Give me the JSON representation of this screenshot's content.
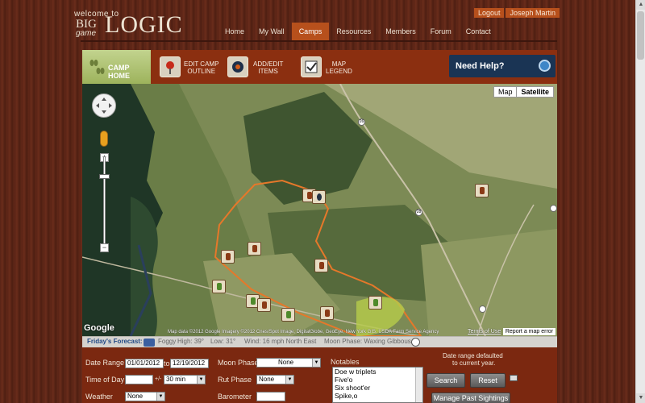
{
  "user": {
    "logout": "Logout",
    "name": "Joseph Martin"
  },
  "logo": {
    "welcome": "welcome to",
    "big": "BIG",
    "game": "game",
    "logic": "LOGIC"
  },
  "nav": [
    {
      "label": "Home"
    },
    {
      "label": "My Wall"
    },
    {
      "label": "Camps",
      "active": true
    },
    {
      "label": "Resources"
    },
    {
      "label": "Members"
    },
    {
      "label": "Forum"
    },
    {
      "label": "Contact"
    }
  ],
  "toolbar": {
    "camp_home": "CAMP HOME",
    "edit_outline_1": "EDIT CAMP",
    "edit_outline_2": "OUTLINE",
    "add_items_1": "ADD/EDIT",
    "add_items_2": "ITEMS",
    "map_legend_1": "MAP",
    "map_legend_2": "LEGEND",
    "need_help": "Need Help?"
  },
  "map": {
    "toggle_map": "Map",
    "toggle_satellite": "Satellite",
    "google": "Google",
    "attribution": "Map data ©2012 Google Imagery ©2012 Cnes/Spot Image, DigitalGlobe, GeoEye, New York GIS, USDA Farm Service Agency",
    "terms": "Terms of Use",
    "report": "Report a map error",
    "route_26": "26",
    "route_28": "28"
  },
  "forecast": {
    "label": "Friday's Forecast:",
    "condition": "Foggy",
    "high": "High: 39°",
    "low": "Low: 31°",
    "wind": "Wind: 16 mph North East",
    "moon": "Moon Phase: Waxing Gibbous"
  },
  "filters": {
    "date_range_label": "Date Range",
    "date_from": "01/01/2012",
    "to": "to",
    "date_to": "12/19/2012",
    "time_of_day_label": "Time of Day",
    "time_value": "",
    "plusminus": "+/-",
    "time_window": "30 min",
    "weather_label": "Weather",
    "weather_value": "None",
    "moon_phase_label": "Moon Phase",
    "moon_phase_value": "None",
    "rut_phase_label": "Rut Phase",
    "rut_phase_value": "None",
    "barometer_label": "Barometer",
    "barometer_value": "",
    "notables_label": "Notables",
    "notables": [
      "Doe w triplets",
      "Five'o",
      "Six shoot'er",
      "Spike,o"
    ],
    "note_line1": "Date range defaulted",
    "note_line2": "to current year.",
    "search": "Search",
    "reset": "Reset",
    "manage": "Manage Past Sightings"
  },
  "colors": {
    "accent": "#b7501c",
    "toolbar": "#8b2f10",
    "panel": "#7b2810",
    "help": "#1a3454"
  }
}
